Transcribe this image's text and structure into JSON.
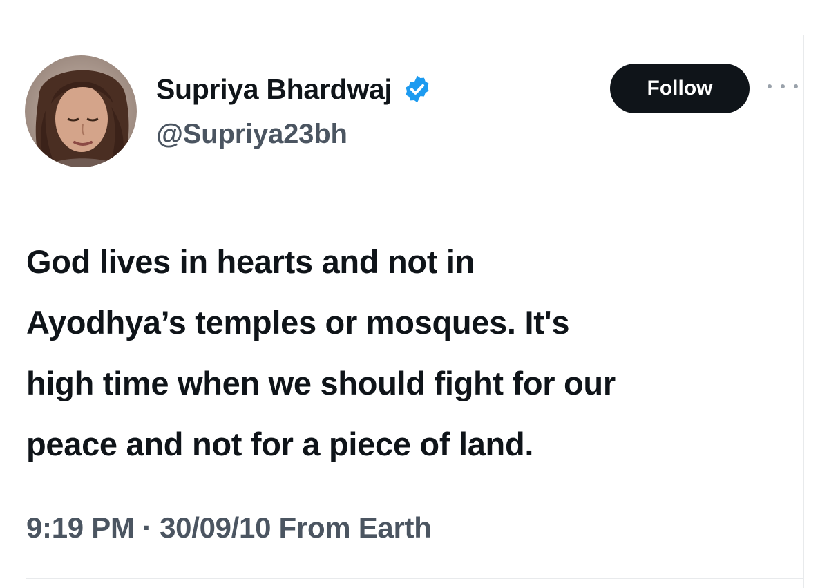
{
  "tweet": {
    "display_name": "Supriya Bhardwaj",
    "handle": "@Supriya23bh",
    "verified_icon": "verified-badge-icon",
    "follow_label": "Follow",
    "more_icon": "more-options-icon",
    "text_lines": [
      "God lives in hearts and not in",
      "Ayodhya’s temples or mosques. It's",
      "high time when we should fight for our",
      "peace and not for a piece of land."
    ],
    "time": "9:19 PM",
    "separator": "·",
    "date": "30/09/10",
    "source": "From Earth"
  },
  "colors": {
    "text_primary": "#0f1419",
    "text_secondary": "#4b5561",
    "verified_blue": "#1d9bf0",
    "follow_bg": "#0f1419",
    "follow_text": "#ffffff"
  }
}
